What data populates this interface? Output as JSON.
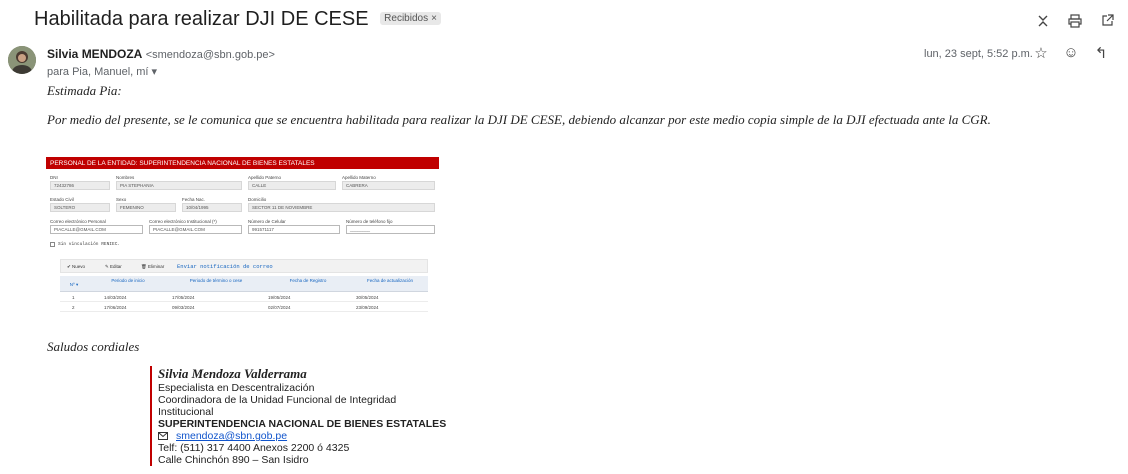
{
  "header": {
    "subject": "Habilitada para realizar DJI DE CESE",
    "label": "Recibidos",
    "label_close": "×",
    "top_icons": [
      "collapse-icon",
      "print-icon",
      "open-new-window-icon"
    ]
  },
  "message": {
    "sender_name": "Silvia MENDOZA",
    "sender_email": "<smendoza@sbn.gob.pe>",
    "to_line": "para Pia, Manuel, mí ▾",
    "date": "lun, 23 sept, 5:52 p.m.",
    "action_icons": [
      "star-icon",
      "emoji-icon",
      "reply-icon",
      "more-icon"
    ]
  },
  "body": {
    "greeting": "Estimada Pia:",
    "paragraph": "Por medio del presente, se le comunica que se encuentra habilitada para realizar la DJI DE CESE, debiendo alcanzar por este medio copia simple de la DJI efectuada ante la CGR.",
    "closing": "Saludos cordiales"
  },
  "form": {
    "title": "PERSONAL DE LA ENTIDAD: SUPERINTENDENCIA NACIONAL DE BIENES ESTATALES",
    "labels": {
      "dni": "DNI",
      "nombres": "Nombres",
      "ap_paterno": "Apellido Paterno",
      "ap_materno": "Apellido Materno",
      "estado_civil": "Estado Civil",
      "sexo": "Sexo",
      "fecha_nac": "Fecha Nac.",
      "domicilio": "Domicilio",
      "correo_personal": "Correo electrónico Personal",
      "correo_inst": "Correo electrónico Institucional (*)",
      "celular": "Número de Celular",
      "tel_fijo": "Número de teléfono fijo"
    },
    "values": {
      "dni": "72432786",
      "nombres": "PIA STEPHANIA",
      "ap_paterno": "CALLE",
      "ap_materno": "CABRERA",
      "estado_civil": "SOLTERO",
      "sexo": "FEMENINO",
      "fecha_nac": "10/04/1995",
      "domicilio": "SECTOR 11 DE NOVIEMBRE",
      "correo_personal": "PIACALLE@GMAIL.COM",
      "correo_inst": "PIACALLE@GMAIL.COM",
      "celular": "991571117",
      "tel_fijo": "________"
    },
    "checkbox_label": "Sin vinculación RENIEC.",
    "toolbar": {
      "nuevo": "✔ Nuevo",
      "editar": "✎ Editar",
      "eliminar": "🗑 Eliminar",
      "link": "Enviar notificación de correo"
    },
    "table": {
      "headers": [
        "Nº ▾",
        "Periodo de inicio",
        "Periodo de término o cese",
        "Fecha de Registro",
        "Fecha de actualización"
      ],
      "rows": [
        [
          "1",
          "14/03/2024",
          "17/05/2024",
          "19/05/2024",
          "30/05/2024"
        ],
        [
          "2",
          "17/06/2024",
          "09/03/2024",
          "02/07/2024",
          "23/09/2024"
        ]
      ]
    }
  },
  "signature": {
    "name": "Silvia Mendoza Valderrama",
    "role": "Especialista en Descentralización",
    "unit": "Coordinadora de la Unidad Funcional de Integridad Institucional",
    "org": "SUPERINTENDENCIA NACIONAL DE BIENES ESTATALES",
    "email": "smendoza@sbn.gob.pe",
    "phone": "Telf: (511) 317 4400 Anexos 2200 ó 4325",
    "address": "Calle Chinchón 890 – San Isidro"
  }
}
